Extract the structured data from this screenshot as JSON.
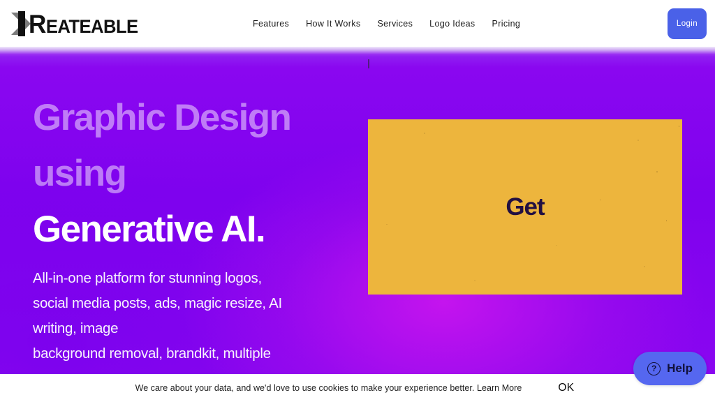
{
  "header": {
    "logo": {
      "mark": "k-arrow-logo",
      "cap": "R",
      "rest": "EATEABLE",
      "full_text": "REATEABLE"
    },
    "nav": [
      {
        "label": "Features"
      },
      {
        "label": "How It Works"
      },
      {
        "label": "Services"
      },
      {
        "label": "Logo Ideas"
      },
      {
        "label": "Pricing"
      }
    ],
    "login_label": "Login",
    "login_color": "#4a61e8"
  },
  "hero": {
    "headline_muted_line1": "Graphic Design",
    "headline_muted_line2": "using",
    "headline_solid": "Generative AI.",
    "subcopy_line1": "All-in-one platform for stunning logos,",
    "subcopy_line2": "social media posts, ads, magic resize, AI",
    "subcopy_line3": "writing, image",
    "subcopy_line4": "background removal, brandkit, multiple",
    "background_start": "#7f02ee",
    "background_accent": "#d618ee"
  },
  "promo_card": {
    "text": "Get",
    "background_color": "#edb53d",
    "text_color": "#221042"
  },
  "help_widget": {
    "label": "Help",
    "icon": "question-mark-circle-icon",
    "glyph": "?",
    "background_color": "#5567f0"
  },
  "cookie_banner": {
    "message": "We care about your data, and we'd love to use cookies to make your experience better.",
    "link_label": "Learn More",
    "accept_label": "OK"
  }
}
